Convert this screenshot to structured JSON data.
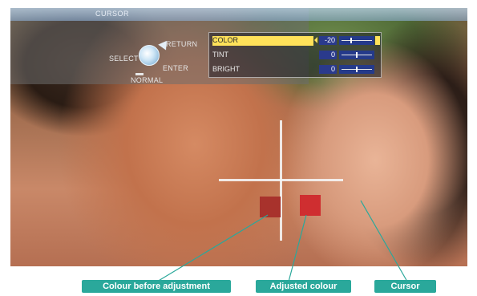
{
  "osd": {
    "title": "CURSOR",
    "controls": {
      "select_label": "SELECT",
      "return_label": "RETURN",
      "enter_label": "ENTER",
      "normal_label": "NORMAL"
    },
    "menu": [
      {
        "name": "COLOR",
        "value": "-20",
        "level": 0.3,
        "selected": true
      },
      {
        "name": "TINT",
        "value": "0",
        "level": 0.5,
        "selected": false
      },
      {
        "name": "BRIGHT",
        "value": "0",
        "level": 0.5,
        "selected": false
      }
    ]
  },
  "swatches": {
    "before_color": "#a8322c",
    "adjusted_color": "#cf2e30"
  },
  "callouts": {
    "before": "Colour before adjustment",
    "adjusted": "Adjusted colour",
    "cursor": "Cursor"
  },
  "colors": {
    "callout_bg": "#2aa89b",
    "highlight": "#ffe25a",
    "value_bg": "#2a3a8c"
  },
  "icons": [
    "dial-icon",
    "arrow-icon",
    "slider-icon"
  ]
}
